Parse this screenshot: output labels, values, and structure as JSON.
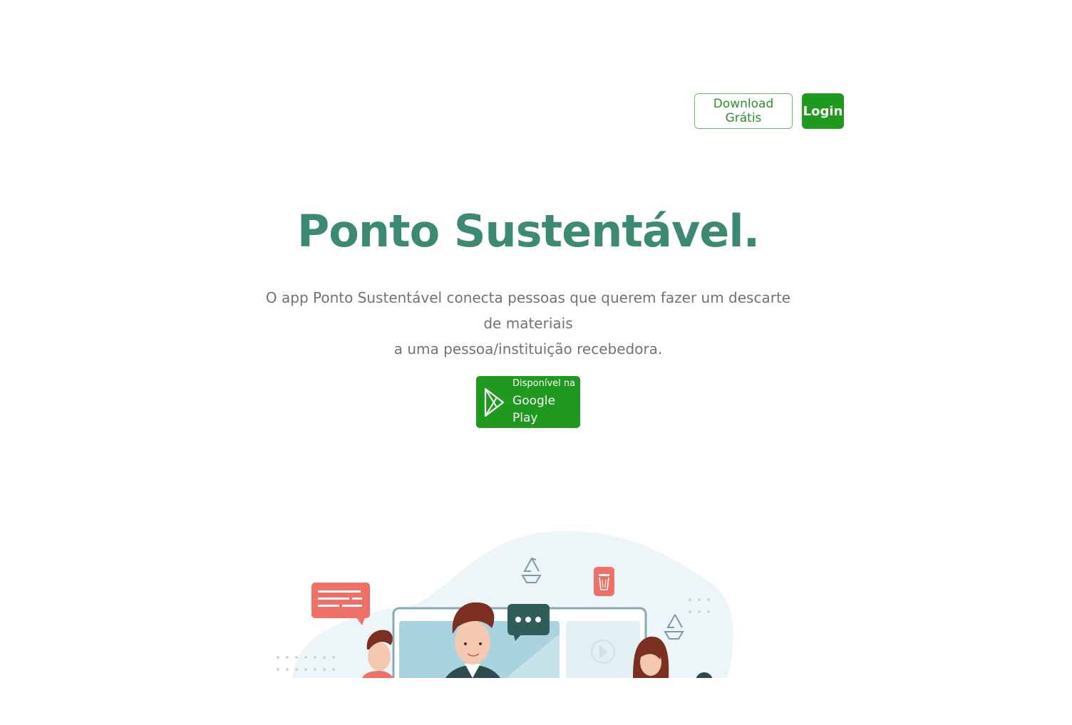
{
  "nav": {
    "download_label": "Download Grátis",
    "login_label": "Login"
  },
  "hero": {
    "title": "Ponto Sustentável.",
    "subtitle_line1": "O app Ponto Sustentável conecta pessoas que querem fazer um descarte de materiais",
    "subtitle_line2": "a uma pessoa/instituição recebedora."
  },
  "store_badge": {
    "small_text": "Disponível na",
    "big_text": "Google Play",
    "icon": "google-play-icon"
  },
  "illustration": {
    "icons": [
      "chat-bubble-icon",
      "recycle-icon",
      "trash-icon",
      "dots-chat-icon",
      "play-icon"
    ]
  },
  "colors": {
    "brand_green": "#1f9a1f",
    "title_teal": "#3c8a74",
    "text_gray": "#6f7377"
  }
}
